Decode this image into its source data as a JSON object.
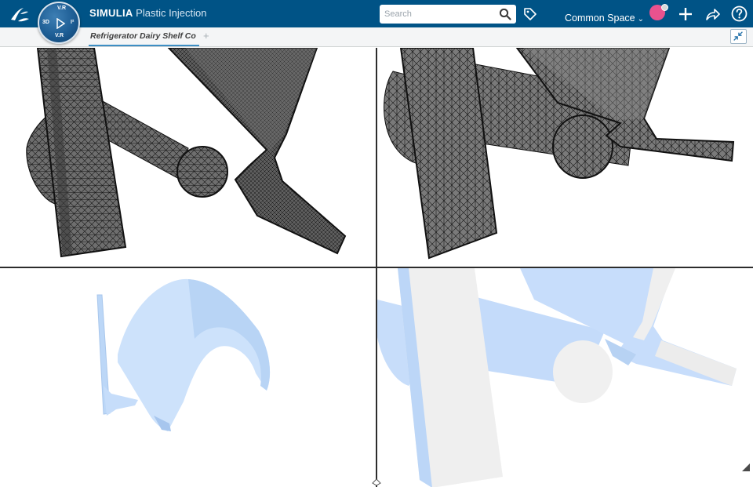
{
  "header": {
    "brand": "SIMULIA",
    "app_name": "Plastic Injection",
    "compass": {
      "top": "V.R",
      "left": "3D",
      "right": "I²",
      "bottom": "V.R"
    },
    "search": {
      "placeholder": "Search",
      "value": ""
    },
    "space_label": "Common Space",
    "icons": [
      "3ds-logo-icon",
      "compass-icon",
      "search-icon",
      "tag-icon",
      "plus-icon",
      "share-icon",
      "help-icon"
    ]
  },
  "tabs": {
    "active_label": "Refrigerator Dairy Shelf Co",
    "add_label": "+"
  },
  "viewport": {
    "views": [
      "mesh-view-top-left",
      "mesh-view-top-right",
      "shaded-view-bottom-left",
      "shaded-view-bottom-right"
    ]
  },
  "colors": {
    "header_bg": "#005386",
    "tab_underline": "#3d8ec4",
    "avatar": "#e8528e",
    "mesh_fill": "#6b6b6b",
    "shaded_part": "#c8defb"
  }
}
